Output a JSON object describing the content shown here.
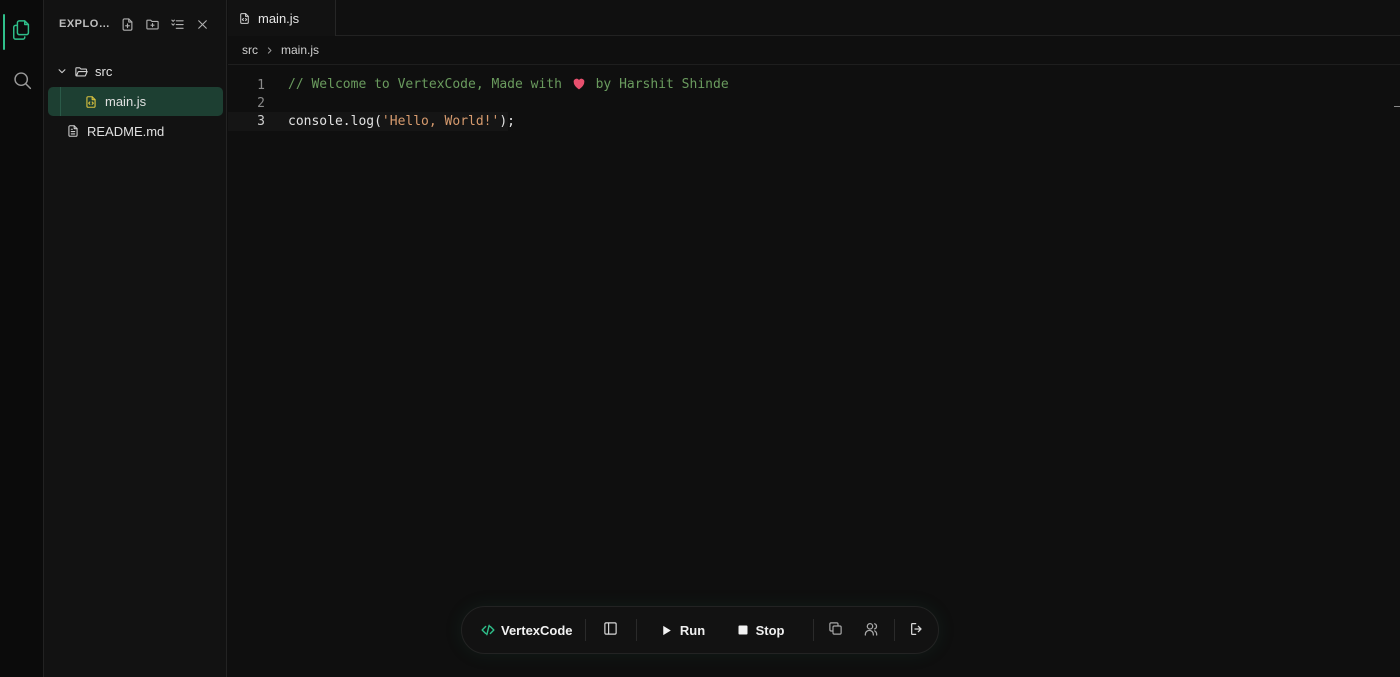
{
  "explorer": {
    "title": "EXPLORER",
    "icons": [
      "new-file-icon",
      "new-folder-icon",
      "collapse-all-icon",
      "close-icon"
    ]
  },
  "tree": {
    "folder": {
      "name": "src"
    },
    "selected_file": {
      "name": "main.js"
    },
    "root_file": {
      "name": "README.md"
    }
  },
  "editor": {
    "tab": {
      "label": "main.js"
    },
    "breadcrumb": {
      "folder": "src",
      "file": "main.js"
    },
    "lines": [
      {
        "number": "1",
        "comment_before": "// Welcome to VertexCode, Made with ",
        "comment_after": " by Harshit Shinde"
      },
      {
        "number": "2"
      },
      {
        "number": "3",
        "code_prefix": "console.log(",
        "code_string": "'Hello, World!'",
        "code_suffix": ");"
      }
    ]
  },
  "toolbar": {
    "brand": "VertexCode",
    "run_label": "Run",
    "stop_label": "Stop"
  },
  "colors": {
    "accent": "#2fbf8a",
    "selection": "#1d3f32",
    "comment": "#6a9b5e",
    "string": "#d79b6e",
    "heart": "#e8506e"
  }
}
